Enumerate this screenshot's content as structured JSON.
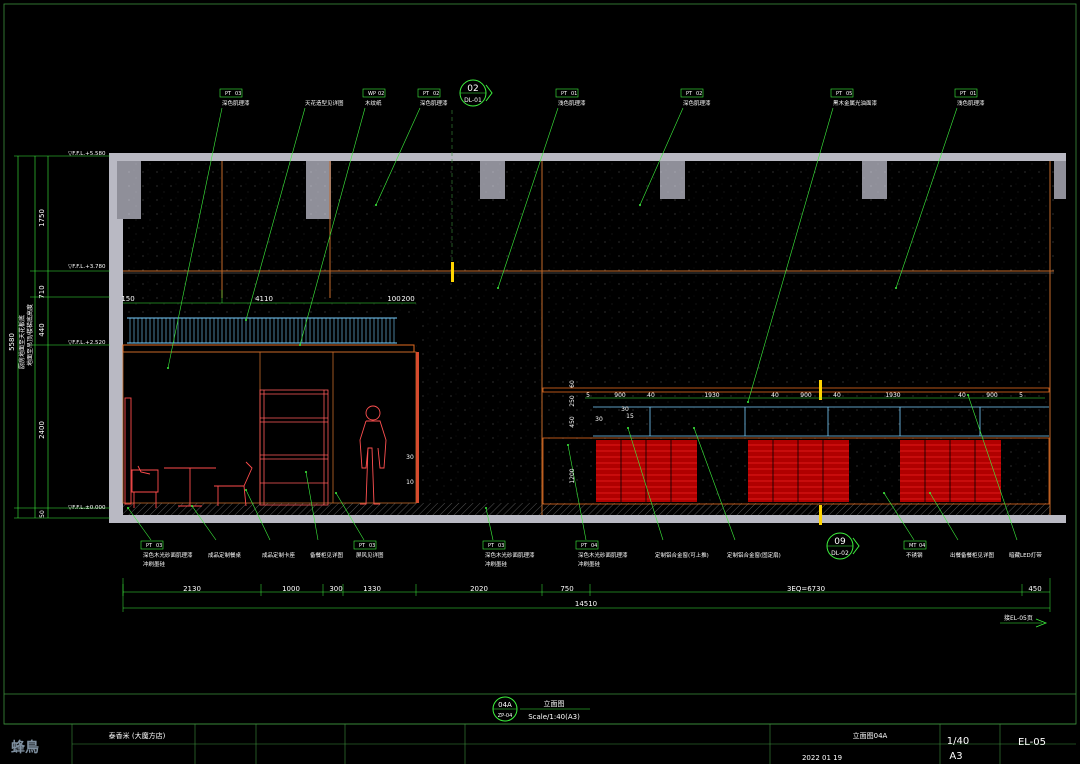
{
  "callouts_top": [
    {
      "code": "PT",
      "num": "03",
      "label": "深色肌理漆"
    },
    {
      "code": "",
      "num": "",
      "label": "天花造型见详图"
    },
    {
      "code": "WP",
      "num": "02",
      "label": "木纹纸"
    },
    {
      "code": "PT",
      "num": "02",
      "label": "深色肌理漆"
    },
    {
      "code": "PT",
      "num": "01",
      "label": "浅色肌理漆"
    },
    {
      "code": "PT",
      "num": "02",
      "label": "深色肌理漆"
    },
    {
      "code": "PT",
      "num": "05",
      "label": "黑木金属光油面漆"
    },
    {
      "code": "PT",
      "num": "01",
      "label": "浅色肌理漆"
    }
  ],
  "callouts_bottom": [
    {
      "code": "PT",
      "num": "03",
      "label": "深色木光砂面肌理漆",
      "sub": "冲刷墨硅"
    },
    {
      "code": "",
      "num": "",
      "label": "成品定制餐桌",
      "sub": ""
    },
    {
      "code": "",
      "num": "",
      "label": "成品定制卡座",
      "sub": ""
    },
    {
      "code": "",
      "num": "",
      "label": "备餐柜见详图",
      "sub": ""
    },
    {
      "code": "PT",
      "num": "03",
      "label": "屏风见详图",
      "sub": ""
    },
    {
      "code": "PT",
      "num": "03",
      "label": "深色木光砂面肌理漆",
      "sub": "冲刷墨硅"
    },
    {
      "code": "PT",
      "num": "04",
      "label": "深色木光砂面肌理漆",
      "sub": "冲刷墨硅"
    },
    {
      "code": "",
      "num": "",
      "label": "定制铝合金窗(可上推)",
      "sub": ""
    },
    {
      "code": "",
      "num": "",
      "label": "定制铝合金窗(固定扇)",
      "sub": ""
    },
    {
      "code": "MT",
      "num": "04",
      "label": "不锈钢",
      "sub": ""
    },
    {
      "code": "",
      "num": "",
      "label": "出餐备餐柜见详图",
      "sub": ""
    },
    {
      "code": "",
      "num": "",
      "label": "暗藏LED灯带",
      "sub": ""
    }
  ],
  "section_markers": [
    {
      "num": "02",
      "ref": "DL-01"
    },
    {
      "num": "09",
      "ref": "DL-02"
    }
  ],
  "levels": [
    "▽F.F.L.+5.580",
    "▽F.F.L.+3.780",
    "▽F.F.L.+2.520",
    "▽F.F.L.±0.000"
  ],
  "left_dims": [
    "1750",
    "710",
    "440",
    "2400",
    "5580",
    "50"
  ],
  "left_vertical_notes": [
    "厨房地面至天花板底",
    "地面至吊顶/楼梯底高度"
  ],
  "mezz_dims": [
    "150",
    "4110",
    "100",
    "200"
  ],
  "window_dims": [
    "5",
    "900",
    "40",
    "1930",
    "40",
    "900",
    "40",
    "1930",
    "40",
    "900",
    "5"
  ],
  "window_small_dims": [
    "30",
    "30",
    "15",
    "60",
    "250",
    "450",
    "1200"
  ],
  "local_dims": [
    "30",
    "10"
  ],
  "bottom_dims": [
    "2130",
    "1000",
    "300",
    "1330",
    "2020",
    "750",
    "3EQ=6730",
    "450"
  ],
  "total_dim": "14510",
  "next_sheet": "接EL-05页",
  "drawing_title": {
    "code": "04A",
    "page": "ZP-04",
    "name": "立面图",
    "scale": "Scale/1:40(A3)"
  },
  "title_block": {
    "brand": "蜂鳥",
    "project": "泰香米 (大魔方店)",
    "sheet_name": "立面图04A",
    "date": "2022 01 19",
    "scale": "1/40",
    "paper": "A3",
    "sheet_no": "EL-05"
  }
}
